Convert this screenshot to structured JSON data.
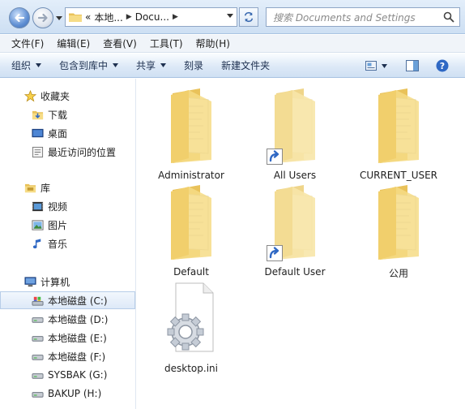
{
  "address": {
    "prefix": "«",
    "segments": [
      "本地...",
      "Docu..."
    ],
    "search_placeholder": "搜索 Documents and Settings"
  },
  "menu": [
    "文件(F)",
    "编辑(E)",
    "查看(V)",
    "工具(T)",
    "帮助(H)"
  ],
  "commands": {
    "organize": "组织",
    "include_library": "包含到库中",
    "share": "共享",
    "burn": "刻录",
    "new_folder": "新建文件夹"
  },
  "nav": {
    "favorites": {
      "label": "收藏夹",
      "items": [
        "下载",
        "桌面",
        "最近访问的位置"
      ]
    },
    "libraries": {
      "label": "库",
      "items": [
        "视频",
        "图片",
        "音乐"
      ]
    },
    "computer": {
      "label": "计算机",
      "drives": [
        "本地磁盘 (C:)",
        "本地磁盘 (D:)",
        "本地磁盘 (E:)",
        "本地磁盘 (F:)",
        "SYSBAK (G:)",
        "BAKUP (H:)"
      ],
      "selected_index": 0
    }
  },
  "items": [
    {
      "name": "Administrator",
      "type": "folder",
      "shortcut": false
    },
    {
      "name": "All Users",
      "type": "folder-empty",
      "shortcut": true
    },
    {
      "name": "CURRENT_USER",
      "type": "folder",
      "shortcut": false
    },
    {
      "name": "Default",
      "type": "folder",
      "shortcut": false
    },
    {
      "name": "Default User",
      "type": "folder-empty",
      "shortcut": true
    },
    {
      "name": "公用",
      "type": "folder",
      "shortcut": false
    },
    {
      "name": "desktop.ini",
      "type": "ini-file",
      "shortcut": false
    }
  ],
  "colors": {
    "accent": "#3c6bb3",
    "folder": "#f0d47a",
    "selection": "#dde9f8"
  }
}
